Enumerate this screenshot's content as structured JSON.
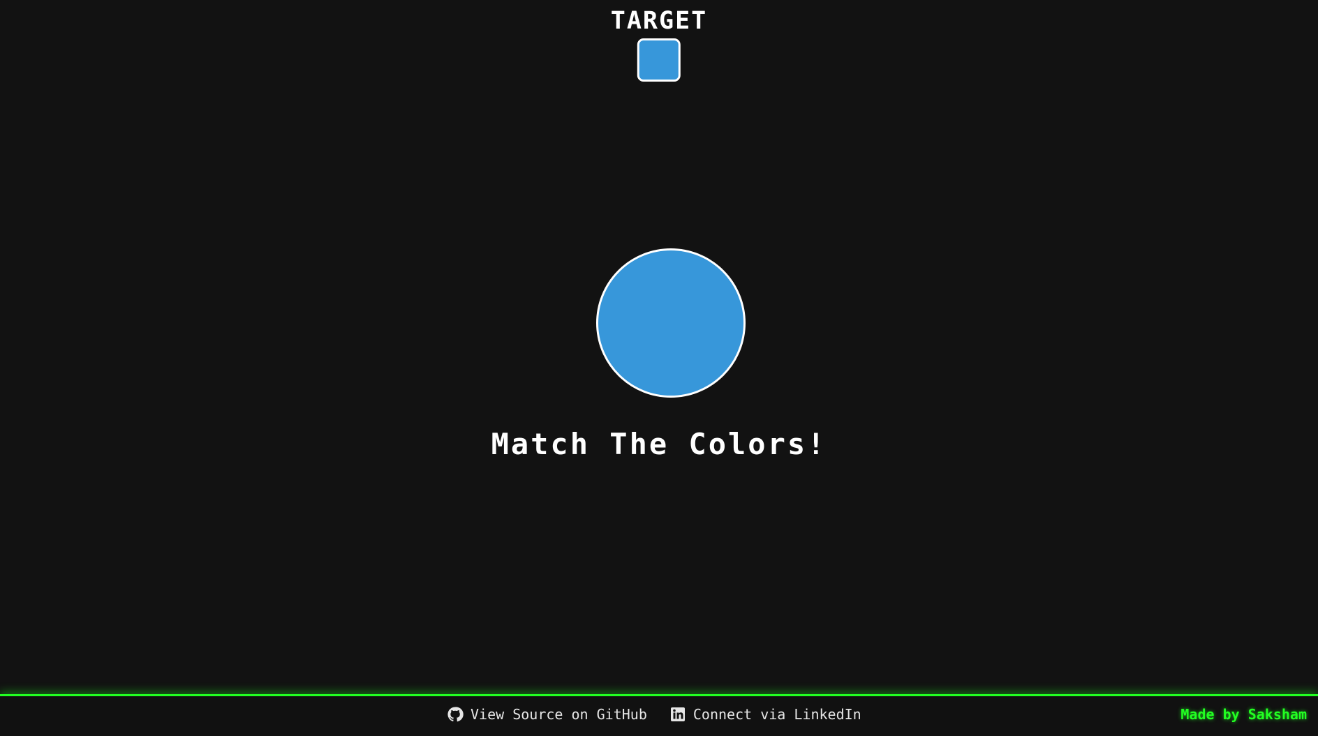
{
  "game": {
    "target_label": "TARGET",
    "target_color": "#3797da",
    "player_color": "#3797da",
    "message": "Match The Colors!"
  },
  "footer": {
    "github_label": "View Source on GitHub",
    "github_icon": "github-icon",
    "linkedin_label": "Connect via LinkedIn",
    "linkedin_icon": "linkedin-icon",
    "credit": "Made by Saksham",
    "accent_color": "#22ff22"
  }
}
